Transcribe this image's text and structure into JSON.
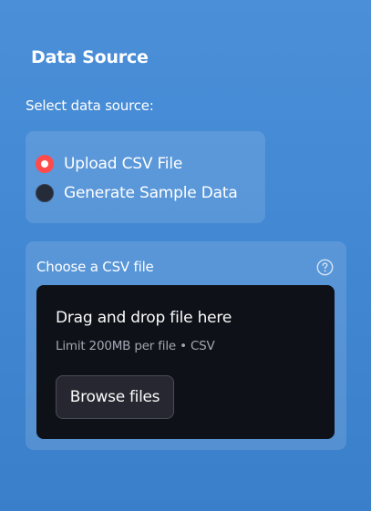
{
  "sidebar": {
    "heading": "Data Source",
    "radio": {
      "label": "Select data source:",
      "options": [
        {
          "label": "Upload CSV File",
          "checked": true
        },
        {
          "label": "Generate Sample Data",
          "checked": false
        }
      ]
    },
    "uploader": {
      "label": "Choose a CSV file",
      "help_icon": "question-circle-icon",
      "drop_title": "Drag and drop file here",
      "drop_limit": "Limit 200MB per file • CSV",
      "browse_label": "Browse files"
    }
  },
  "colors": {
    "background": "#4288d3",
    "accent": "#ff4b4b",
    "dropzone": "#0e1117",
    "button": "#262730"
  }
}
